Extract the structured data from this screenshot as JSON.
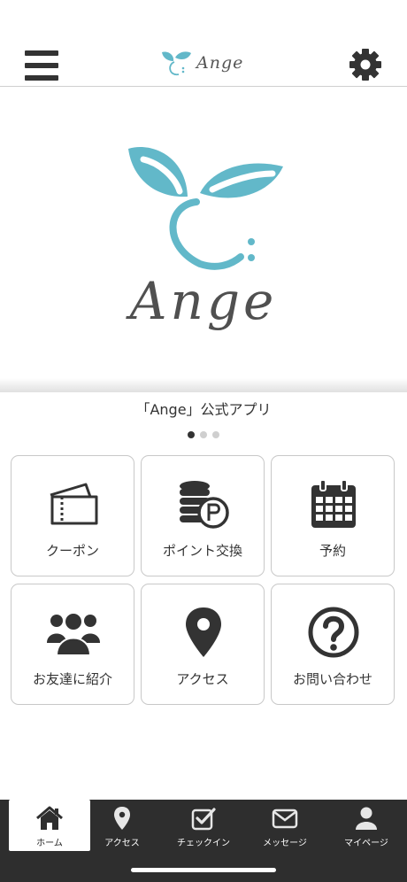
{
  "header": {
    "logo_text": "Ange",
    "menu_icon": "hamburger-icon",
    "settings_icon": "gear-icon"
  },
  "hero": {
    "logo_word": "Ange"
  },
  "caption": "「Ange」公式アプリ",
  "carousel": {
    "pages": 3,
    "active": 1
  },
  "tiles": [
    {
      "label": "クーポン",
      "icon": "ticket-icon"
    },
    {
      "label": "ポイント交換",
      "icon": "coins-icon"
    },
    {
      "label": "予約",
      "icon": "calendar-icon"
    },
    {
      "label": "お友達に紹介",
      "icon": "people-icon"
    },
    {
      "label": "アクセス",
      "icon": "map-pin-icon"
    },
    {
      "label": "お問い合わせ",
      "icon": "question-icon"
    }
  ],
  "tabbar": [
    {
      "label": "ホーム",
      "icon": "home-icon",
      "active": true
    },
    {
      "label": "アクセス",
      "icon": "map-pin-icon",
      "active": false
    },
    {
      "label": "チェックイン",
      "icon": "checkbox-icon",
      "active": false
    },
    {
      "label": "メッセージ",
      "icon": "mail-icon",
      "active": false
    },
    {
      "label": "マイページ",
      "icon": "user-icon",
      "active": false
    }
  ],
  "colors": {
    "brand_teal": "#62b8c9",
    "dark": "#333333",
    "tabbar_bg": "#2e2e2e",
    "border": "#c8c8c8"
  }
}
